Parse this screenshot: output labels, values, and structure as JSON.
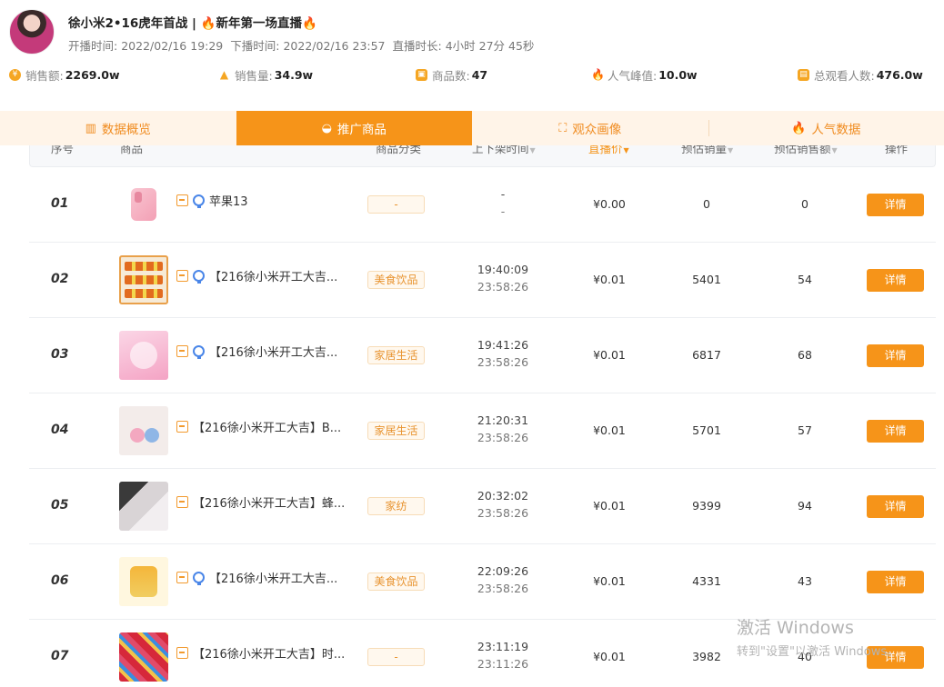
{
  "header": {
    "title_prefix": "徐小米2•16虎年首战 | ",
    "title_flame_icon": "🔥",
    "title_main": "新年第一场直播",
    "start_label": "开播时间:",
    "start_value": "2022/02/16 19:29",
    "end_label": "下播时间:",
    "end_value": "2022/02/16 23:57",
    "duration_label": "直播时长:",
    "duration_value": "4小时 27分 45秒"
  },
  "stats": [
    {
      "label": "销售额:",
      "value": "2269.0w",
      "icon": "coin-icon"
    },
    {
      "label": "销售量:",
      "value": "34.9w",
      "icon": "chart-icon"
    },
    {
      "label": "商品数:",
      "value": "47",
      "icon": "bag-icon"
    },
    {
      "label": "人气峰值:",
      "value": "10.0w",
      "icon": "flame-icon"
    },
    {
      "label": "总观看人数:",
      "value": "476.0w",
      "icon": "gift-icon"
    }
  ],
  "tabs": [
    {
      "label": "数据概览",
      "icon": "bar-chart-icon",
      "active": false
    },
    {
      "label": "推广商品",
      "icon": "basket-icon",
      "active": true
    },
    {
      "label": "观众画像",
      "icon": "scan-icon",
      "active": false
    },
    {
      "label": "人气数据",
      "icon": "flame-icon",
      "active": false
    }
  ],
  "table": {
    "headers": {
      "index": "序号",
      "product": "商品",
      "category": "商品分类",
      "time": "上下架时间",
      "price": "直播价",
      "sales": "预估销量",
      "amount": "预估销售额",
      "action": "操作"
    },
    "detail_label": "详情",
    "rows": [
      {
        "index": "01",
        "name": "苹果13",
        "category": "-",
        "time_up": "-",
        "time_down": "-",
        "price": "¥0.00",
        "sales": "0",
        "amount": "0"
      },
      {
        "index": "02",
        "name": "【216徐小米开工大吉...",
        "category": "美食饮品",
        "time_up": "19:40:09",
        "time_down": "23:58:26",
        "price": "¥0.01",
        "sales": "5401",
        "amount": "54"
      },
      {
        "index": "03",
        "name": "【216徐小米开工大吉...",
        "category": "家居生活",
        "time_up": "19:41:26",
        "time_down": "23:58:26",
        "price": "¥0.01",
        "sales": "6817",
        "amount": "68"
      },
      {
        "index": "04",
        "name": "【216徐小米开工大吉】B...",
        "category": "家居生活",
        "time_up": "21:20:31",
        "time_down": "23:58:26",
        "price": "¥0.01",
        "sales": "5701",
        "amount": "57"
      },
      {
        "index": "05",
        "name": "【216徐小米开工大吉】蜂...",
        "category": "家纺",
        "time_up": "20:32:02",
        "time_down": "23:58:26",
        "price": "¥0.01",
        "sales": "9399",
        "amount": "94"
      },
      {
        "index": "06",
        "name": "【216徐小米开工大吉...",
        "category": "美食饮品",
        "time_up": "22:09:26",
        "time_down": "23:58:26",
        "price": "¥0.01",
        "sales": "4331",
        "amount": "43"
      },
      {
        "index": "07",
        "name": "【216徐小米开工大吉】时...",
        "category": "-",
        "time_up": "23:11:19",
        "time_down": "23:11:26",
        "price": "¥0.01",
        "sales": "3982",
        "amount": "40"
      }
    ]
  },
  "watermark": {
    "line1": "激活 Windows",
    "line2": "转到\"设置\"以激活 Windows。"
  }
}
